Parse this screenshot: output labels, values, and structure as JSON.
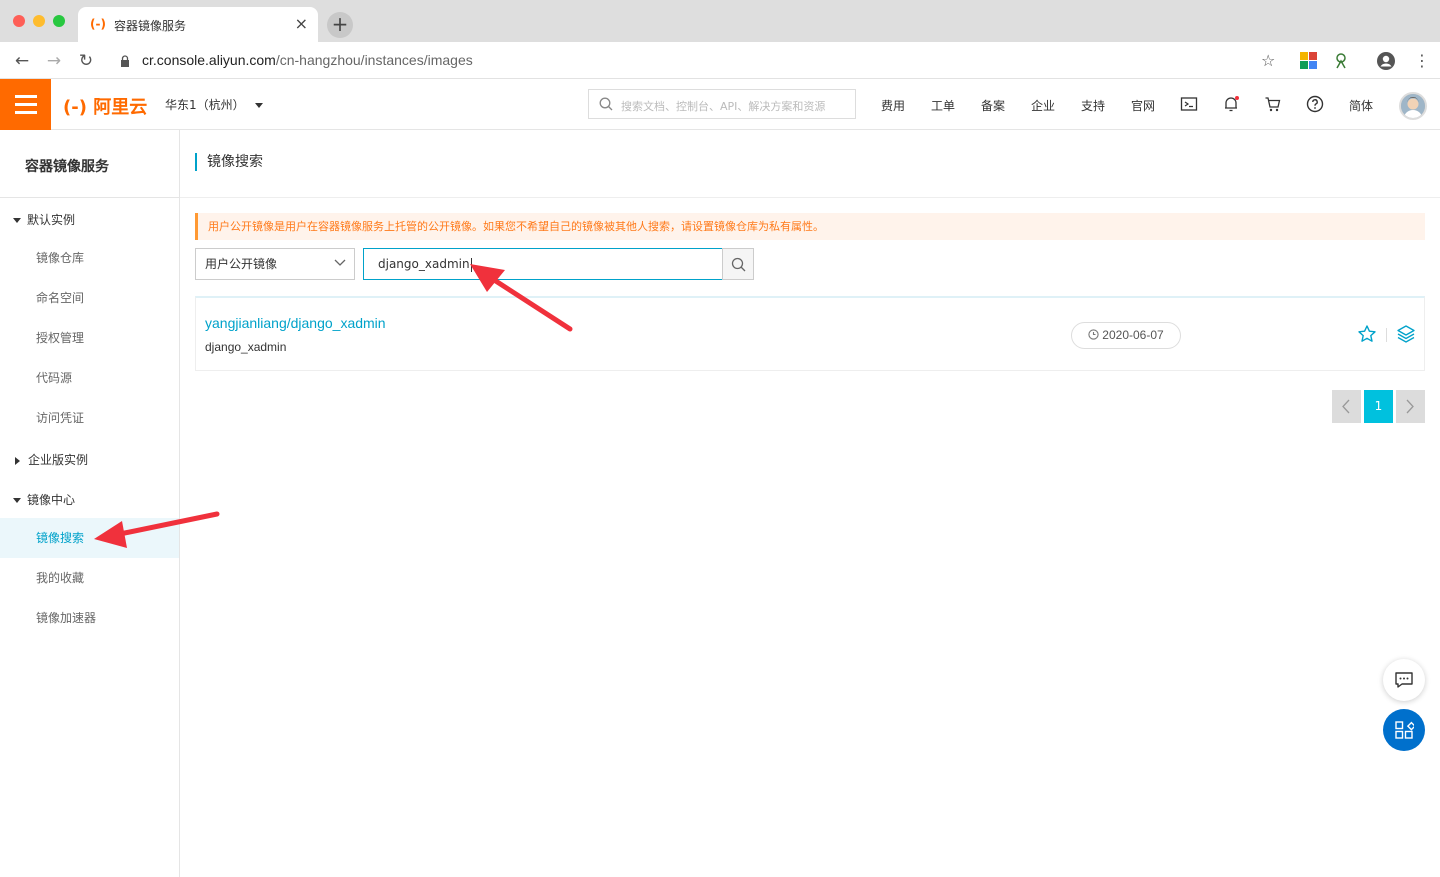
{
  "browser": {
    "tab_title": "容器镜像服务",
    "tab_close": "×",
    "new_tab": "+",
    "url_host": "cr.console.aliyun.com",
    "url_path": "/cn-hangzhou/instances/images"
  },
  "header": {
    "logo": "阿里云",
    "region": "华东1（杭州）",
    "search_placeholder": "搜索文档、控制台、API、解决方案和资源",
    "nav": [
      "费用",
      "工单",
      "备案",
      "企业",
      "支持",
      "官网"
    ],
    "lang": "简体"
  },
  "sidebar": {
    "title": "容器镜像服务",
    "groups": [
      {
        "label": "默认实例",
        "expanded": true
      },
      {
        "label": "企业版实例",
        "expanded": false
      },
      {
        "label": "镜像中心",
        "expanded": true
      }
    ],
    "items": [
      {
        "label": "镜像仓库"
      },
      {
        "label": "命名空间"
      },
      {
        "label": "授权管理"
      },
      {
        "label": "代码源"
      },
      {
        "label": "访问凭证"
      },
      {
        "label": "镜像搜索",
        "active": true
      },
      {
        "label": "我的收藏"
      },
      {
        "label": "镜像加速器"
      }
    ]
  },
  "main": {
    "page_title": "镜像搜索",
    "notice": "用户公开镜像是用户在容器镜像服务上托管的公开镜像。如果您不希望自己的镜像被其他人搜索，请设置镜像仓库为私有属性。",
    "select_value": "用户公开镜像",
    "search_value": "django_xadmin",
    "result": {
      "title": "yangjianliang/django_xadmin",
      "subtitle": "django_xadmin",
      "date": "2020-06-07"
    },
    "pagination": {
      "current": "1"
    }
  },
  "colors": {
    "brand": "#ff6a00",
    "accent": "#00a2ca",
    "page_active": "#00c1de",
    "annotation_arrow": "#f0313c"
  }
}
